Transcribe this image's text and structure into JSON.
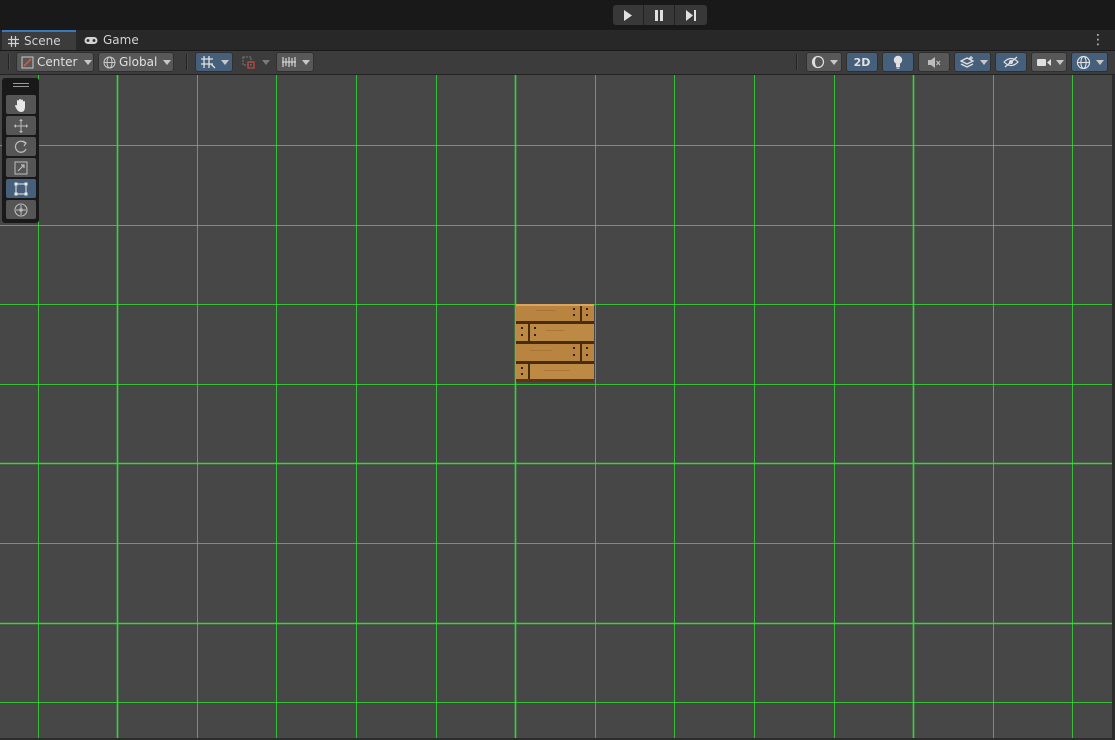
{
  "play_controls": {
    "play": "play-icon",
    "pause": "pause-icon",
    "step": "step-icon"
  },
  "tabs": [
    {
      "label": "Scene",
      "icon": "grid-icon",
      "active": true
    },
    {
      "label": "Game",
      "icon": "gamepad-icon",
      "active": false
    }
  ],
  "toolbar": {
    "pivot_label": "Center",
    "space_label": "Global",
    "mode_2d_label": "2D",
    "accent_color": "#46607c"
  },
  "scene": {
    "grid_color": "#33dd33",
    "background": "#474747",
    "sprite": "wooden-crate"
  },
  "tools": [
    "hand-tool",
    "move-tool",
    "rotate-tool",
    "scale-tool",
    "rect-tool",
    "transform-tool"
  ]
}
